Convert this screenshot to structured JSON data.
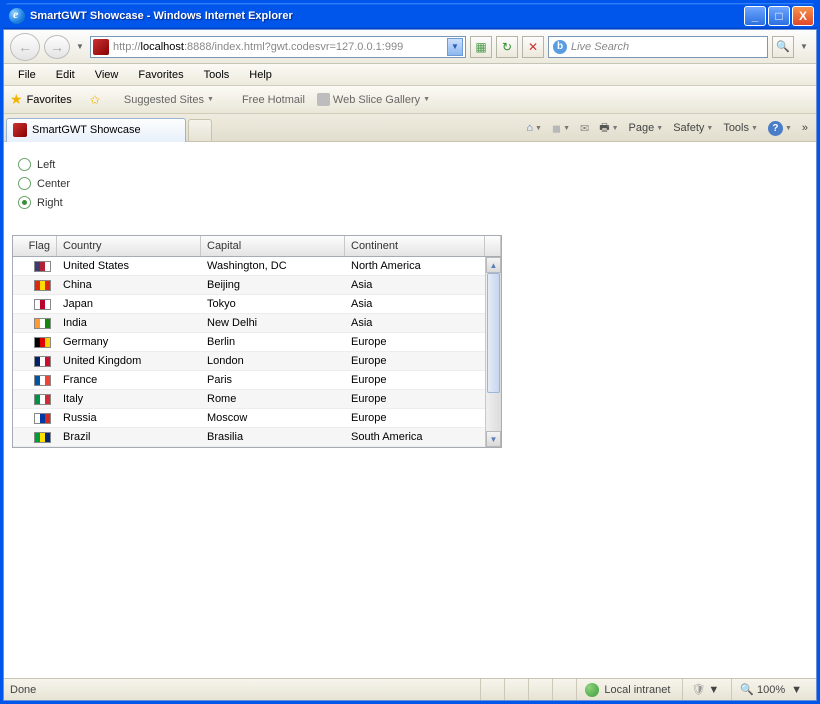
{
  "window": {
    "title": "SmartGWT Showcase - Windows Internet Explorer"
  },
  "address": {
    "prefix": "http://",
    "host": "localhost",
    "rest": ":8888/index.html?gwt.codesvr=127.0.0.1:999"
  },
  "search": {
    "placeholder": "Live Search"
  },
  "menu": {
    "file": "File",
    "edit": "Edit",
    "view": "View",
    "favorites": "Favorites",
    "tools": "Tools",
    "help": "Help"
  },
  "favbar": {
    "label": "Favorites",
    "suggested": "Suggested Sites",
    "hotmail": "Free Hotmail",
    "webslice": "Web Slice Gallery"
  },
  "tab": {
    "title": "SmartGWT Showcase"
  },
  "toolbar": {
    "page": "Page",
    "safety": "Safety",
    "tools": "Tools"
  },
  "radios": {
    "left": "Left",
    "center": "Center",
    "right": "Right",
    "selected": "right"
  },
  "grid": {
    "columns": {
      "flag": "Flag",
      "country": "Country",
      "capital": "Capital",
      "continent": "Continent"
    },
    "rows": [
      {
        "flagColors": [
          "#3c3b6e",
          "#b22234",
          "#ffffff"
        ],
        "country": "United States",
        "capital": "Washington, DC",
        "continent": "North America"
      },
      {
        "flagColors": [
          "#de2910",
          "#ffde00",
          "#de2910"
        ],
        "country": "China",
        "capital": "Beijing",
        "continent": "Asia"
      },
      {
        "flagColors": [
          "#ffffff",
          "#bc002d",
          "#ffffff"
        ],
        "country": "Japan",
        "capital": "Tokyo",
        "continent": "Asia"
      },
      {
        "flagColors": [
          "#ff9933",
          "#ffffff",
          "#138808"
        ],
        "country": "India",
        "capital": "New Delhi",
        "continent": "Asia"
      },
      {
        "flagColors": [
          "#000000",
          "#dd0000",
          "#ffce00"
        ],
        "country": "Germany",
        "capital": "Berlin",
        "continent": "Europe"
      },
      {
        "flagColors": [
          "#012169",
          "#ffffff",
          "#c8102e"
        ],
        "country": "United Kingdom",
        "capital": "London",
        "continent": "Europe"
      },
      {
        "flagColors": [
          "#0055a4",
          "#ffffff",
          "#ef4135"
        ],
        "country": "France",
        "capital": "Paris",
        "continent": "Europe"
      },
      {
        "flagColors": [
          "#009246",
          "#ffffff",
          "#ce2b37"
        ],
        "country": "Italy",
        "capital": "Rome",
        "continent": "Europe"
      },
      {
        "flagColors": [
          "#ffffff",
          "#0039a6",
          "#d52b1e"
        ],
        "country": "Russia",
        "capital": "Moscow",
        "continent": "Europe"
      },
      {
        "flagColors": [
          "#009c3b",
          "#ffdf00",
          "#002776"
        ],
        "country": "Brazil",
        "capital": "Brasilia",
        "continent": "South America"
      }
    ]
  },
  "status": {
    "left": "Done",
    "zone": "Local intranet",
    "zoom": "100%"
  }
}
